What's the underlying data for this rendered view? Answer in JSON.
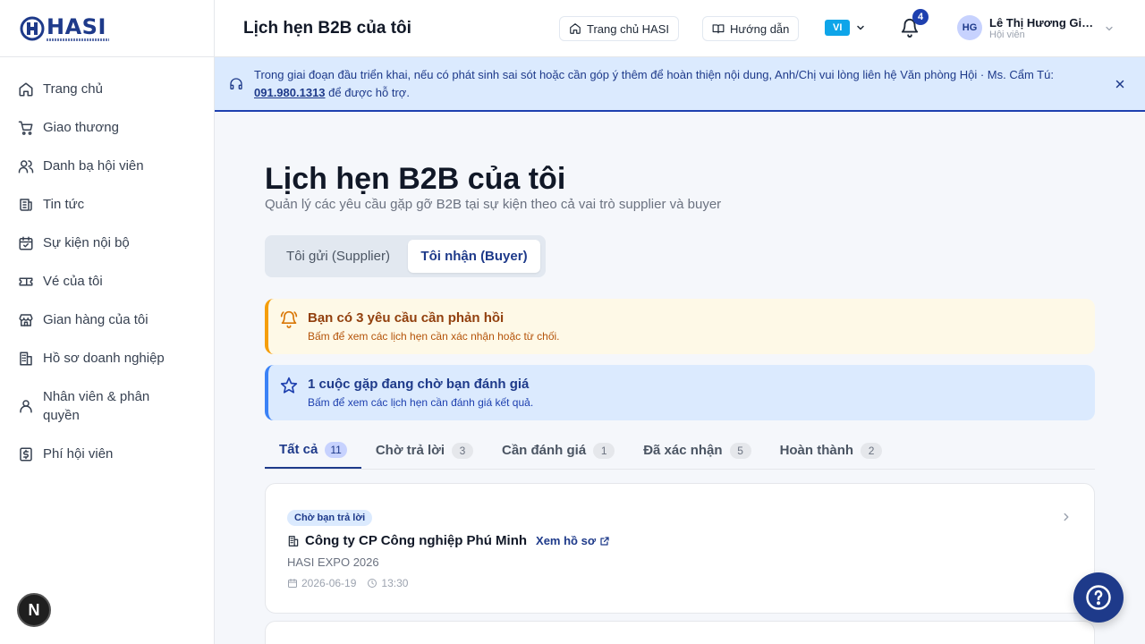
{
  "brand": {
    "name": "HASI"
  },
  "sidebar": {
    "items": [
      {
        "label": "Trang chủ",
        "icon": "home-icon"
      },
      {
        "label": "Giao thương",
        "icon": "cart-icon"
      },
      {
        "label": "Danh bạ hội viên",
        "icon": "users-icon"
      },
      {
        "label": "Tin tức",
        "icon": "news-icon"
      },
      {
        "label": "Sự kiện nội bộ",
        "icon": "calendar-check-icon"
      },
      {
        "label": "Vé của tôi",
        "icon": "ticket-icon"
      },
      {
        "label": "Gian hàng của tôi",
        "icon": "store-icon"
      },
      {
        "label": "Hồ sơ doanh nghiệp",
        "icon": "building-icon"
      },
      {
        "label": "Nhân viên & phân quyền",
        "icon": "user-icon"
      },
      {
        "label": "Phí hội viên",
        "icon": "dollar-icon"
      }
    ],
    "badge_letter": "N"
  },
  "header": {
    "title": "Lịch hẹn B2B của tôi",
    "home_button": "Trang chủ HASI",
    "guide_button": "Hướng dẫn",
    "lang": "VI",
    "notifications": "4",
    "user": {
      "initials": "HG",
      "name": "Lê Thị Hương Giang",
      "role": "Hội viên"
    }
  },
  "notice": {
    "text_before": "Trong giai đoạn đầu triển khai, nếu có phát sinh sai sót hoặc cần góp ý thêm để hoàn thiện nội dung, Anh/Chị vui lòng liên hệ Văn phòng Hội · Ms. Cẩm Tú: ",
    "phone": "091.980.1313",
    "text_after": " để được hỗ trợ."
  },
  "main": {
    "title": "Lịch hẹn B2B của tôi",
    "subtitle": "Quản lý các yêu cầu gặp gỡ B2B tại sự kiện theo cả vai trò supplier và buyer",
    "segments": [
      "Tôi gửi (Supplier)",
      "Tôi nhận (Buyer)"
    ],
    "alert_warn": {
      "title": "Bạn có 3 yêu cầu cần phản hồi",
      "desc": "Bấm để xem các lịch hẹn cần xác nhận hoặc từ chối."
    },
    "alert_info": {
      "title": "1 cuộc gặp đang chờ bạn đánh giá",
      "desc": "Bấm để xem các lịch hẹn cần đánh giá kết quả."
    },
    "tabs": [
      {
        "label": "Tất cả",
        "count": "11"
      },
      {
        "label": "Chờ trả lời",
        "count": "3"
      },
      {
        "label": "Cần đánh giá",
        "count": "1"
      },
      {
        "label": "Đã xác nhận",
        "count": "5"
      },
      {
        "label": "Hoàn thành",
        "count": "2"
      }
    ],
    "card": {
      "status": "Chờ bạn trả lời",
      "company": "Công ty CP Công nghiệp Phú Minh",
      "view_profile": "Xem hồ sơ",
      "event": "HASI EXPO 2026",
      "date": "2026-06-19",
      "time": "13:30"
    }
  },
  "colors": {
    "primary": "#1e3a8a",
    "warn": "#f59e0b",
    "info": "#3b82f6",
    "lang": "#0ea5e9"
  }
}
